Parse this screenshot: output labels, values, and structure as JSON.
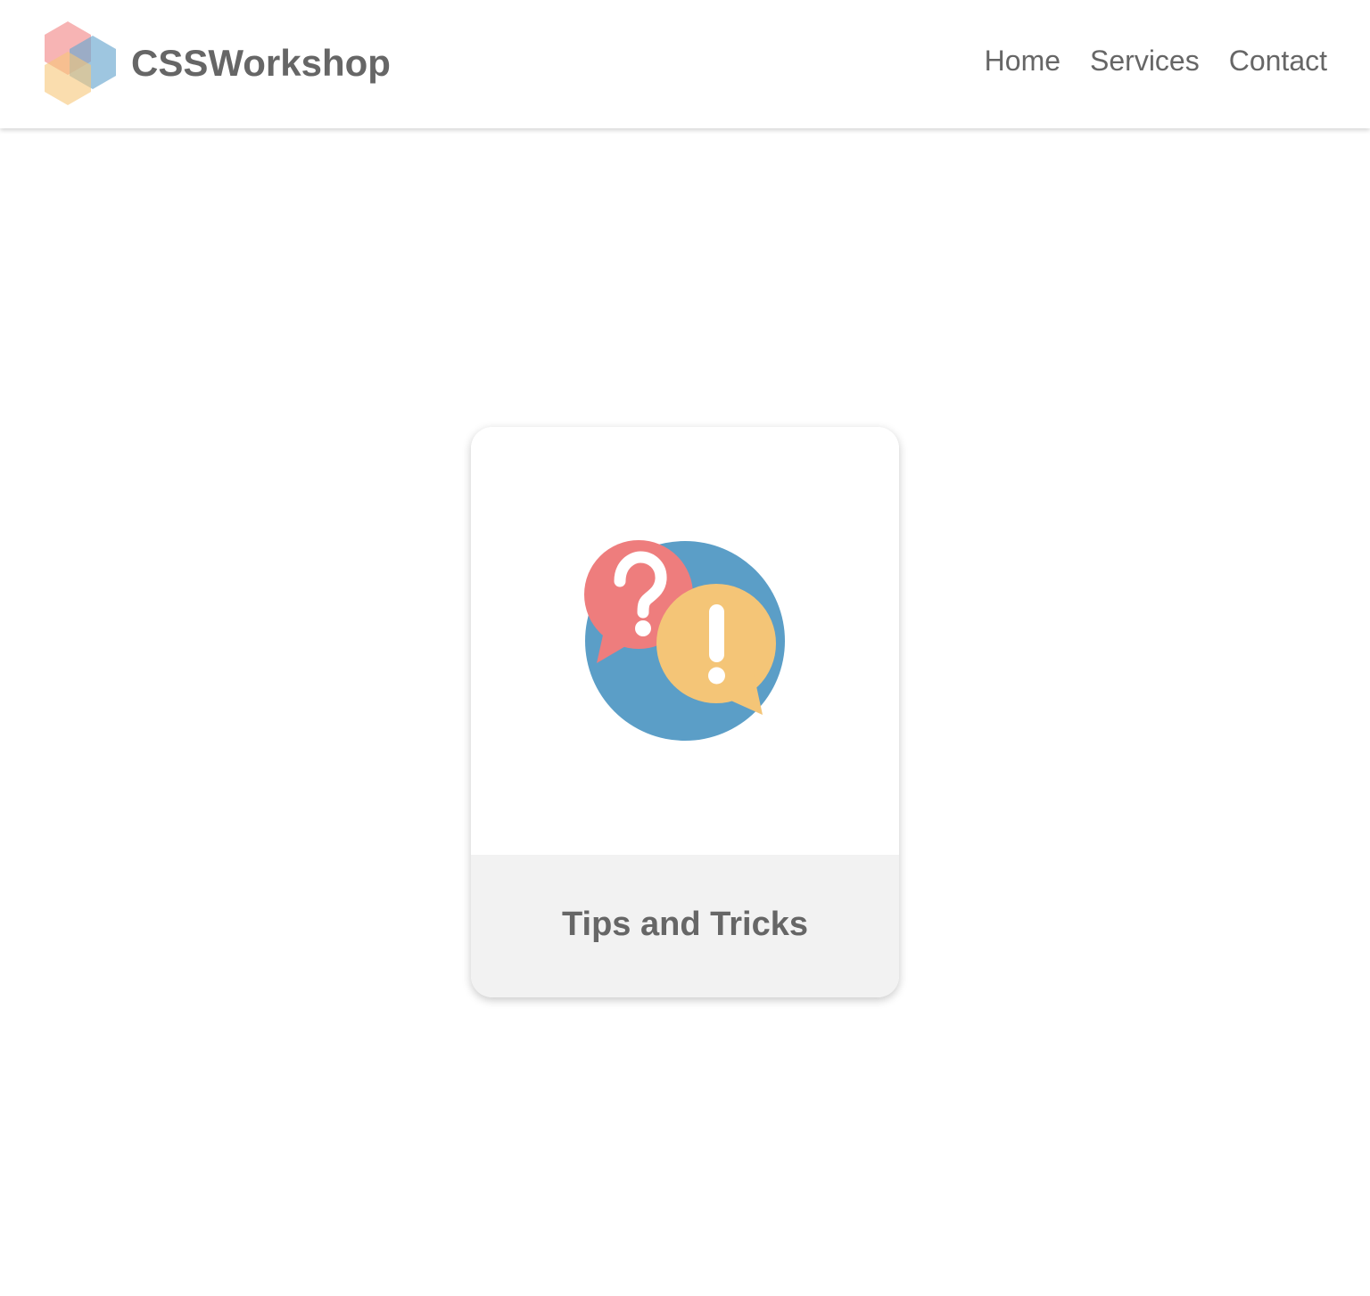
{
  "header": {
    "brand_name": "CSSWorkshop",
    "logo_icon": "hexagon-logo-icon",
    "nav": [
      {
        "label": "Home"
      },
      {
        "label": "Services"
      },
      {
        "label": "Contact"
      }
    ]
  },
  "card": {
    "icon": "question-exclamation-chat-icon",
    "title": "Tips and Tricks"
  },
  "colors": {
    "text": "#666666",
    "card_footer_bg": "#f2f2f2",
    "accent_blue": "#5b9ec7",
    "accent_red": "#ee7d7d",
    "accent_yellow": "#f4c577"
  }
}
